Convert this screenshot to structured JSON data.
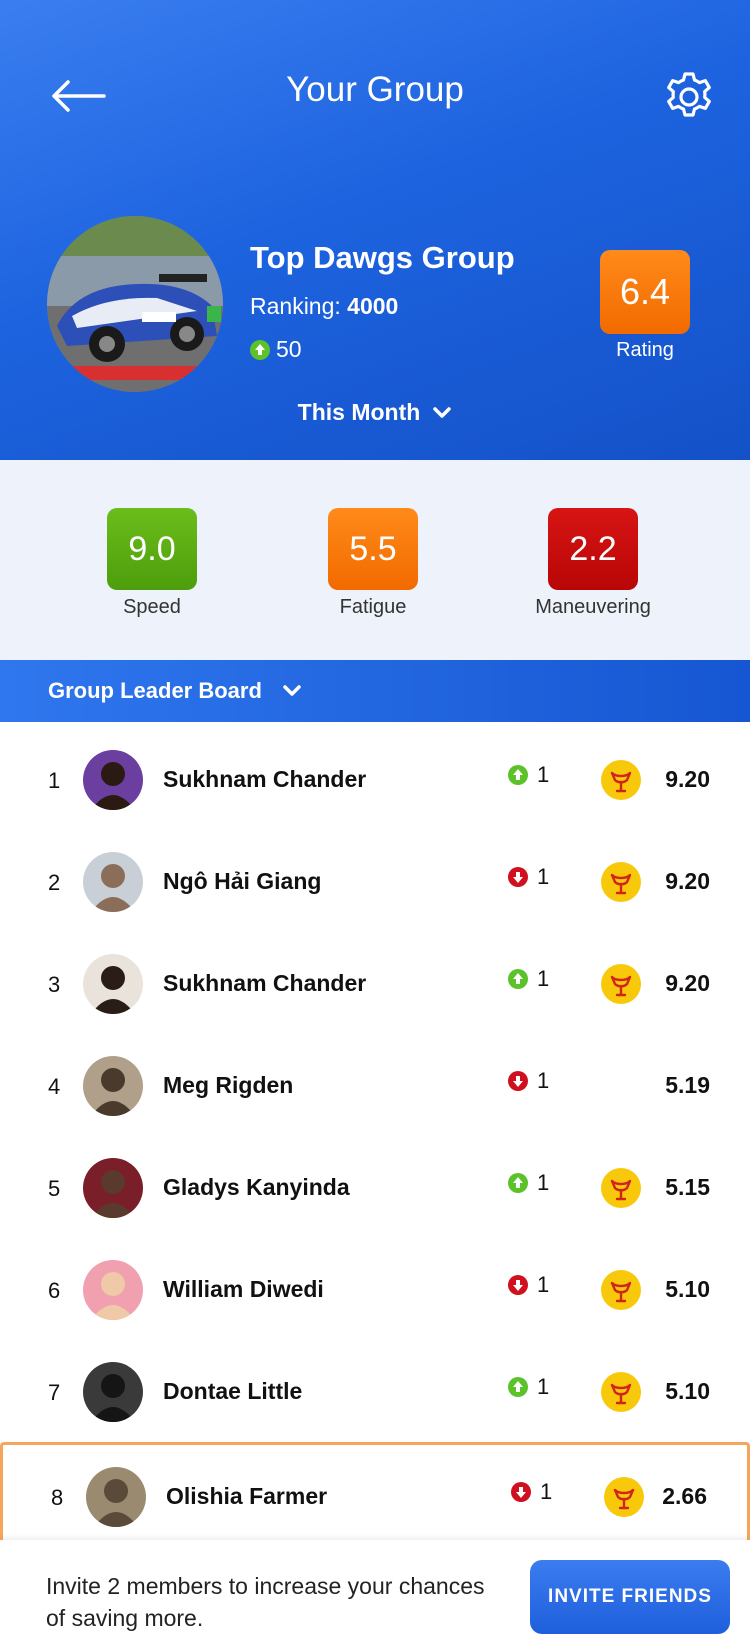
{
  "header": {
    "title": "Your Group",
    "back_icon": "arrow-left-icon",
    "settings_icon": "gear-icon"
  },
  "group": {
    "name": "Top Dawgs Group",
    "ranking_label": "Ranking:",
    "ranking_value": "4000",
    "change": "50",
    "change_direction": "up",
    "rating_value": "6.4",
    "rating_label": "Rating",
    "period": "This Month"
  },
  "metrics": [
    {
      "value": "9.0",
      "label": "Speed",
      "color": "#5aa912"
    },
    {
      "value": "5.5",
      "label": "Fatigue",
      "color": "#f47c0f"
    },
    {
      "value": "2.2",
      "label": "Maneuvering",
      "color": "#c50a0a"
    }
  ],
  "leaderboard": {
    "title": "Group Leader Board",
    "rows": [
      {
        "rank": "1",
        "name": "Sukhnam Chander",
        "trend": "up",
        "delta": "1",
        "medal": true,
        "score": "9.20"
      },
      {
        "rank": "2",
        "name": "Ngô Hải Giang",
        "trend": "down",
        "delta": "1",
        "medal": true,
        "score": "9.20"
      },
      {
        "rank": "3",
        "name": "Sukhnam Chander",
        "trend": "up",
        "delta": "1",
        "medal": true,
        "score": "9.20"
      },
      {
        "rank": "4",
        "name": "Meg Rigden",
        "trend": "down",
        "delta": "1",
        "medal": false,
        "score": "5.19"
      },
      {
        "rank": "5",
        "name": "Gladys Kanyinda",
        "trend": "up",
        "delta": "1",
        "medal": true,
        "score": "5.15"
      },
      {
        "rank": "6",
        "name": "William Diwedi",
        "trend": "down",
        "delta": "1",
        "medal": true,
        "score": "5.10"
      },
      {
        "rank": "7",
        "name": "Dontae Little",
        "trend": "up",
        "delta": "1",
        "medal": true,
        "score": "5.10"
      },
      {
        "rank": "8",
        "name": "Olishia Farmer",
        "trend": "down",
        "delta": "1",
        "medal": true,
        "score": "2.66"
      }
    ]
  },
  "footer": {
    "invite_text": "Invite 2 members to increase your chances of saving more.",
    "invite_button": "INVITE FRIENDS"
  },
  "colors": {
    "primary": "#1d63df",
    "trend_up": "#5cc22a",
    "trend_down": "#d0101e",
    "medal": "#f7c90a",
    "highlight_border": "#f6a65a"
  }
}
